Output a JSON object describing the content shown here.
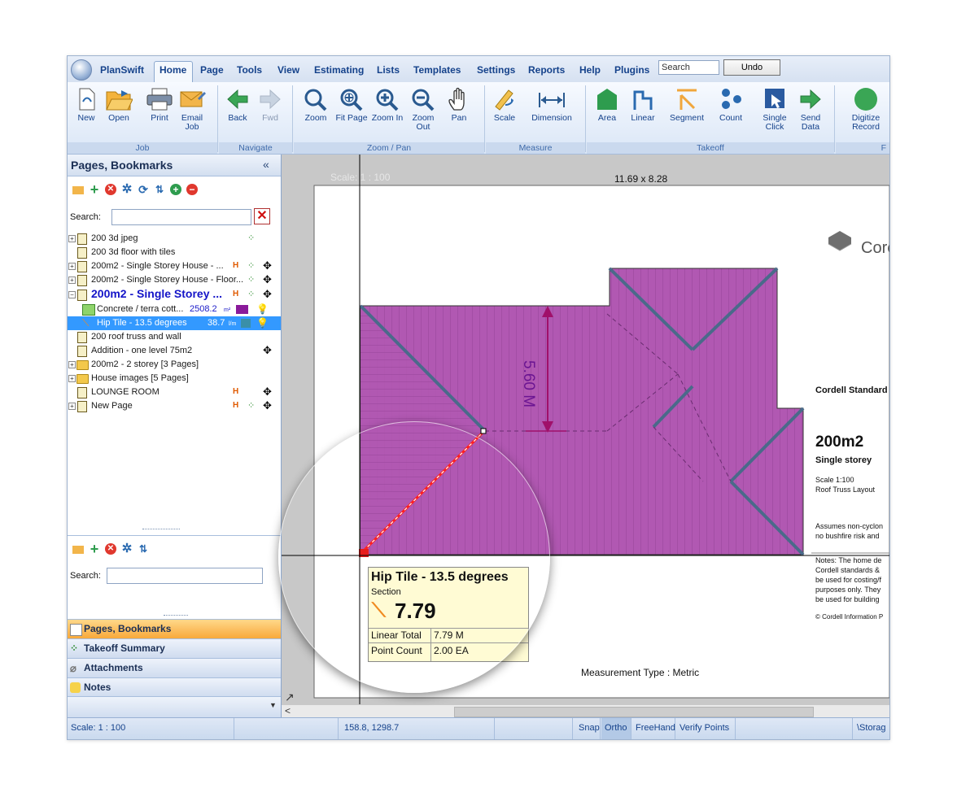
{
  "menu": {
    "app_name": "PlanSwift",
    "tabs": [
      "Home",
      "Page",
      "Tools",
      "View",
      "Estimating",
      "Lists",
      "Templates",
      "Settings",
      "Reports",
      "Help",
      "Plugins"
    ],
    "search_value": "Search",
    "undo_label": "Undo"
  },
  "ribbon": {
    "buttons": {
      "new": "New",
      "open": "Open",
      "print": "Print",
      "email": "Email Job",
      "back": "Back",
      "fwd": "Fwd",
      "zoom": "Zoom",
      "fit_page": "Fit Page",
      "zoom_in": "Zoom In",
      "zoom_out": "Zoom Out",
      "pan": "Pan",
      "scale": "Scale",
      "dimension": "Dimension",
      "area": "Area",
      "linear": "Linear",
      "segment": "Segment",
      "count": "Count",
      "single_click": "Single Click",
      "send_data": "Send Data",
      "digitize": "Digitize Record"
    },
    "groups": {
      "job": "Job",
      "navigate": "Navigate",
      "zoom_pan": "Zoom / Pan",
      "measure": "Measure",
      "takeoff": "Takeoff",
      "f": "F"
    }
  },
  "left_panel": {
    "title": "Pages, Bookmarks",
    "collapse": "«",
    "search_label": "Search:",
    "tree": [
      {
        "label": "200 3d jpeg"
      },
      {
        "label": "200 3d floor with tiles"
      },
      {
        "label": "200m2 - Single Storey House - ..."
      },
      {
        "label": "200m2 - Single Storey House - Floor..."
      },
      {
        "label": "200m2 - Single Storey ..."
      },
      {
        "label": "Concrete / terra cott...",
        "value": "2508.2",
        "unit": "m²"
      },
      {
        "label": "Hip Tile - 13.5 degrees",
        "value": "38.7",
        "unit": "l/m"
      },
      {
        "label": "200 roof truss and wall"
      },
      {
        "label": "Addition - one level 75m2"
      },
      {
        "label": "200m2 - 2 storey [3 Pages]"
      },
      {
        "label": "House images [5 Pages]"
      },
      {
        "label": "LOUNGE ROOM"
      },
      {
        "label": "New Page"
      }
    ],
    "search2_label": "Search:",
    "nav": {
      "pages": "Pages, Bookmarks",
      "takeoff": "Takeoff Summary",
      "attachments": "Attachments",
      "notes": "Notes"
    }
  },
  "canvas": {
    "scale_label": "Scale: 1 : 100",
    "page_size": "11.69 x 8.28",
    "dimension_label": "5.60 M",
    "measurement_type": "Measurement Type : Metric",
    "title_block": {
      "logo": "Core",
      "company": "Cordell Standard",
      "plan_title": "200m2",
      "plan_sub": "Single storey",
      "scale": "Scale 1:100",
      "layout": "Roof Truss Layout",
      "assumes1": "Assumes non-cyclon",
      "assumes2": "no bushfire risk and",
      "notes1": "Notes: The home de",
      "notes2": "Cordell standards &",
      "notes3": "be used for costing/f",
      "notes4": "purposes only. They",
      "notes5": "be used for building",
      "copyright": "© Cordell Information P"
    },
    "tooltip": {
      "title": "Hip Tile - 13.5 degrees",
      "type": "Section",
      "value": "7.79",
      "linear_total_label": "Linear Total",
      "linear_total_value": "7.79 M",
      "point_count_label": "Point Count",
      "point_count_value": "2.00 EA"
    }
  },
  "status": {
    "scale": "Scale: 1 : 100",
    "coords": "158.8, 1298.7",
    "snap": "Snap",
    "ortho": "Ortho",
    "freehand": "FreeHand",
    "verify": "Verify Points",
    "path": "\\Storag"
  },
  "colors": {
    "roof_fill": "#b158b2",
    "roof_line": "#8e3d92",
    "hip_line": "#4a6a8a",
    "accent_orange": "#f8a93b",
    "ribbon_text": "#15428b"
  }
}
